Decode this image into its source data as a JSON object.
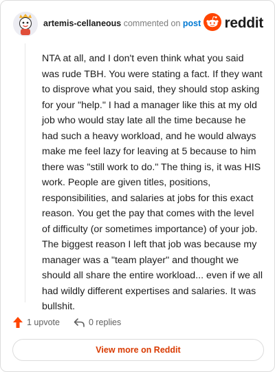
{
  "comment": {
    "author": "artemis-cellaneous",
    "action_text": "commented on",
    "target_link": "post",
    "body": "NTA at all, and I don't even think what you said was rude TBH. You were stating a fact. If they want to disprove what you said, they should stop asking for your \"help.\" I had a manager like this at my old job who would stay late all the time because he had such a heavy workload, and he would always make me feel lazy for leaving at 5 because to him there was \"still work to do.\" The thing is, it was HIS work. People are given titles, positions, responsibilities, and salaries at jobs for this exact reason. You get the pay that comes with the level of difficulty (or sometimes importance) of your job. The biggest reason I left that job was because my manager was a \"team player\" and thought we should all share the entire workload... even if we all had wildly different expertises and salaries. It was bullshit."
  },
  "brand": {
    "wordmark": "reddit",
    "color": "#ff4500",
    "icon": "reddit-snoo-icon"
  },
  "actions": {
    "upvotes": "1 upvote",
    "replies": "0 replies",
    "upvote_icon": "upvote-arrow-icon",
    "reply_icon": "reply-arrow-icon",
    "upvote_color": "#ff4500"
  },
  "footer": {
    "view_more": "View more on Reddit",
    "link_color": "#d93a00"
  }
}
